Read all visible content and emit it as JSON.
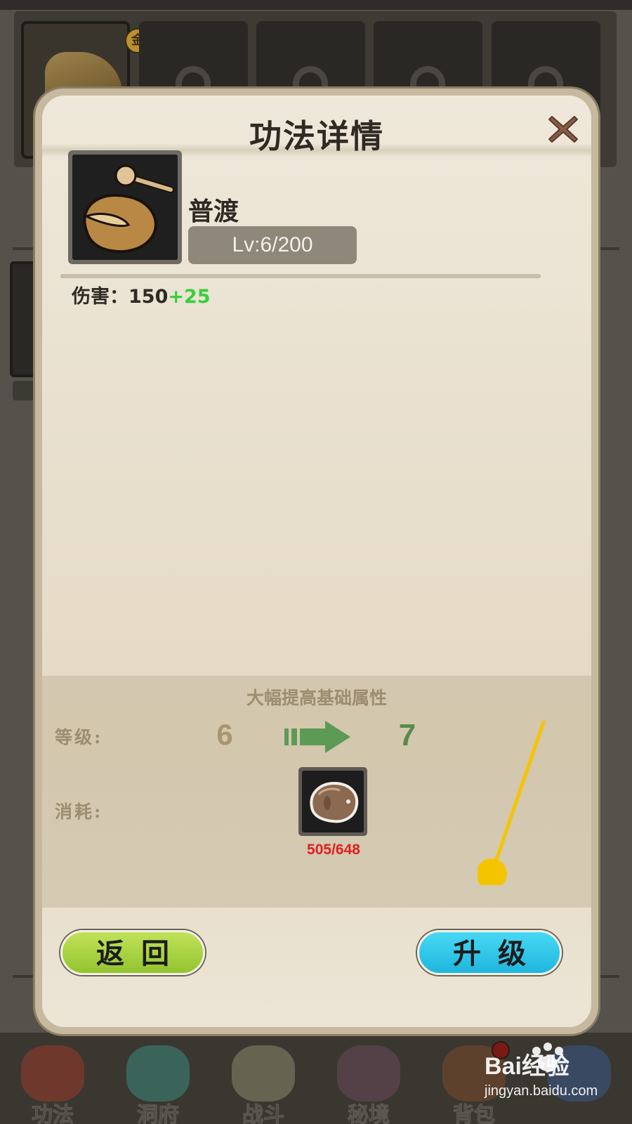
{
  "background": {
    "equipped_badge": "金",
    "bottom_nav": [
      {
        "label": "功法",
        "icon": "scroll-icon"
      },
      {
        "label": "洞府",
        "icon": "cave-icon"
      },
      {
        "label": "战斗",
        "icon": "sword-icon"
      },
      {
        "label": "秘境",
        "icon": "realm-icon"
      },
      {
        "label": "背包",
        "icon": "backpack-icon"
      },
      {
        "label": "",
        "icon": "shop-icon"
      }
    ]
  },
  "modal": {
    "title": "功法详情",
    "item": {
      "name": "普渡",
      "level": "Lv:6/200",
      "stat_label": "伤害：",
      "stat_value": "150",
      "stat_bonus": "+25",
      "icon": "gourd-icon"
    },
    "upgrade": {
      "description": "大幅提高基础属性",
      "level_label": "等级:",
      "level_from": "6",
      "level_to": "7",
      "cost_label": "消耗:",
      "cost_icon": "material-icon",
      "cost_count": "505/648"
    },
    "buttons": {
      "back": "返回",
      "upgrade": "升级"
    }
  },
  "watermark": {
    "brand": "Bai经验",
    "url": "jingyan.baidu.com"
  },
  "colors": {
    "modal_bg": "#e8dfcd",
    "back_button": "#a8d23e",
    "upgrade_button": "#2fc6e8",
    "bonus_green": "#36d03a",
    "cost_red": "#e02020",
    "guide_yellow": "#f5c400"
  }
}
